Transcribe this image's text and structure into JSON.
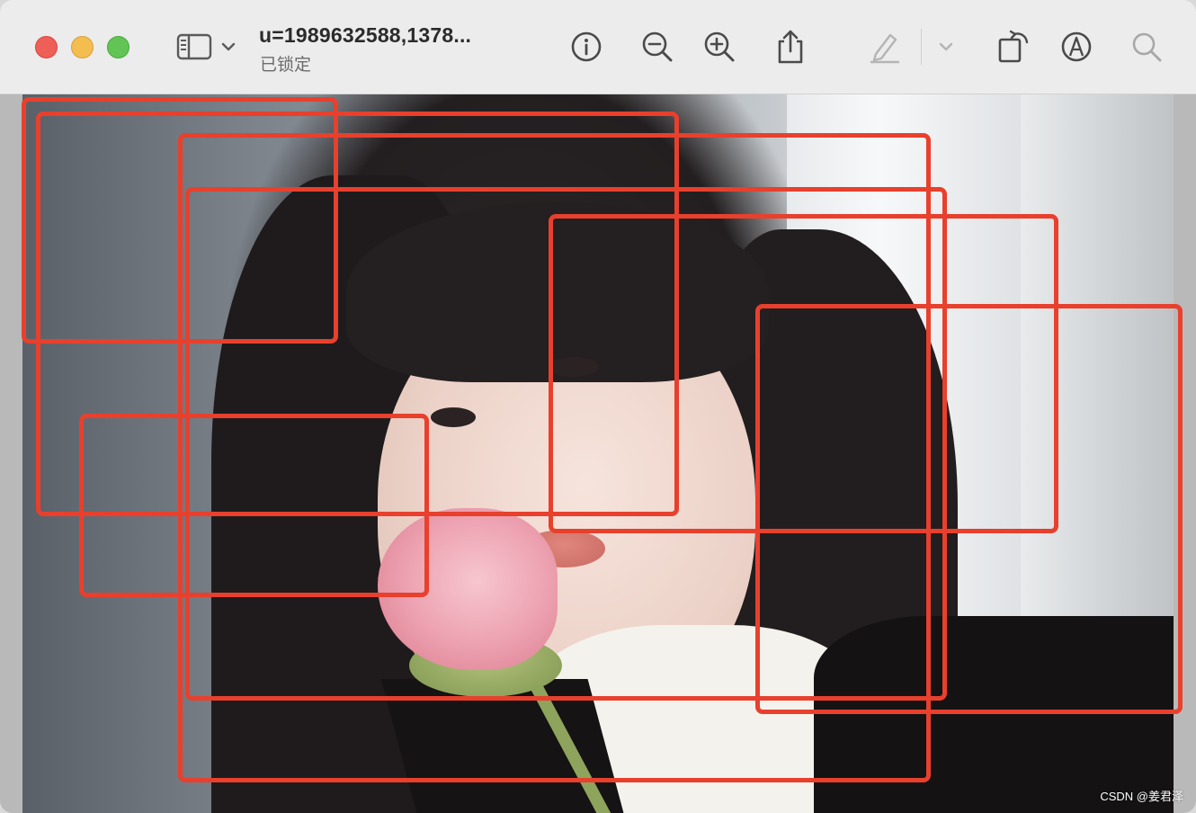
{
  "window": {
    "title": "u=1989632588,1378...",
    "subtitle": "已锁定"
  },
  "toolbar": {
    "icons": [
      "sidebar-toggle-icon",
      "chevron-down-icon",
      "info-icon",
      "zoom-out-icon",
      "zoom-in-icon",
      "share-icon",
      "markup-pen-icon",
      "chevron-down-icon",
      "rotate-icon",
      "markup-icon",
      "search-icon"
    ]
  },
  "image": {
    "description_visible": "photo",
    "watermark": "CSDN @姜君泽",
    "annotation_color": "#e8402d",
    "bounding_box_count": 7
  },
  "colors": {
    "close": "#ee5f57",
    "minimize": "#f4bd4f",
    "zoom": "#61c454"
  }
}
